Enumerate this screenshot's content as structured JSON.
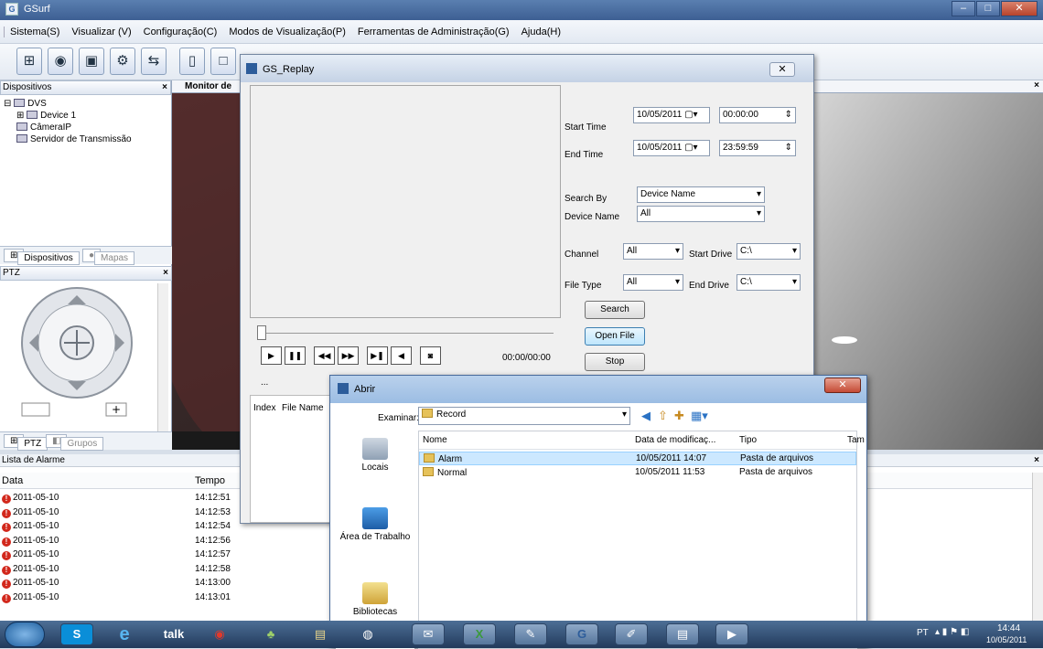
{
  "app": {
    "title": "GSurf",
    "icon": "gsurf-icon"
  },
  "menu": [
    "Sistema(S)",
    "Visualizar (V)",
    "Configuração(C)",
    "Modos de Visualização(P)",
    "Ferramentas de Administração(G)",
    "Ajuda(H)"
  ],
  "devices": {
    "title": "Dispositivos",
    "tree": [
      "DVS",
      "Device 1",
      "CâmeraIP",
      "Servidor de Transmissão"
    ],
    "tabs": [
      "Dispositivos",
      "Mapas"
    ]
  },
  "ptz": {
    "title": "PTZ",
    "tabs": [
      "PTZ",
      "Grupos"
    ]
  },
  "monitor": {
    "tab": "Monitor de"
  },
  "alarm": {
    "title": "Lista de Alarme",
    "col_date": "Data",
    "col_time": "Tempo",
    "rows": [
      [
        "2011-05-10",
        "14:12:51"
      ],
      [
        "2011-05-10",
        "14:12:53"
      ],
      [
        "2011-05-10",
        "14:12:54"
      ],
      [
        "2011-05-10",
        "14:12:56"
      ],
      [
        "2011-05-10",
        "14:12:57"
      ],
      [
        "2011-05-10",
        "14:12:58"
      ],
      [
        "2011-05-10",
        "14:13:00"
      ],
      [
        "2011-05-10",
        "14:13:01"
      ]
    ]
  },
  "replay": {
    "title": "GS_Replay",
    "start_time_label": "Start Time",
    "start_date": "10/05/2011",
    "start_time": "00:00:00",
    "end_time_label": "End Time",
    "end_date": "10/05/2011",
    "end_time": "23:59:59",
    "search_by_label": "Search By",
    "search_by": "Device Name",
    "device_name_label": "Device Name",
    "device_name": "All",
    "channel_label": "Channel",
    "channel": "All",
    "start_drive_label": "Start Drive",
    "start_drive": "C:\\",
    "file_type_label": "File Type",
    "file_type": "All",
    "end_drive_label": "End Drive",
    "end_drive": "C:\\",
    "search_btn": "Search",
    "open_btn": "Open File",
    "stop_btn": "Stop",
    "time_display": "00:00/00:00",
    "col_index": "Index",
    "col_file": "File Name",
    "ellipsis": "..."
  },
  "open_dialog": {
    "title": "Abrir",
    "look_in_label": "Examinar:",
    "look_in": "Record",
    "places": [
      "Locais",
      "Área de Trabalho",
      "Bibliotecas"
    ],
    "cols": [
      "Nome",
      "Data de modificaç...",
      "Tipo",
      "Tam"
    ],
    "files": [
      {
        "name": "Alarm",
        "date": "10/05/2011 14:07",
        "type": "Pasta de arquivos"
      },
      {
        "name": "Normal",
        "date": "10/05/2011 11:53",
        "type": "Pasta de arquivos"
      }
    ]
  },
  "tray": {
    "lang": "PT",
    "time": "14:44",
    "date": "10/05/2011"
  }
}
